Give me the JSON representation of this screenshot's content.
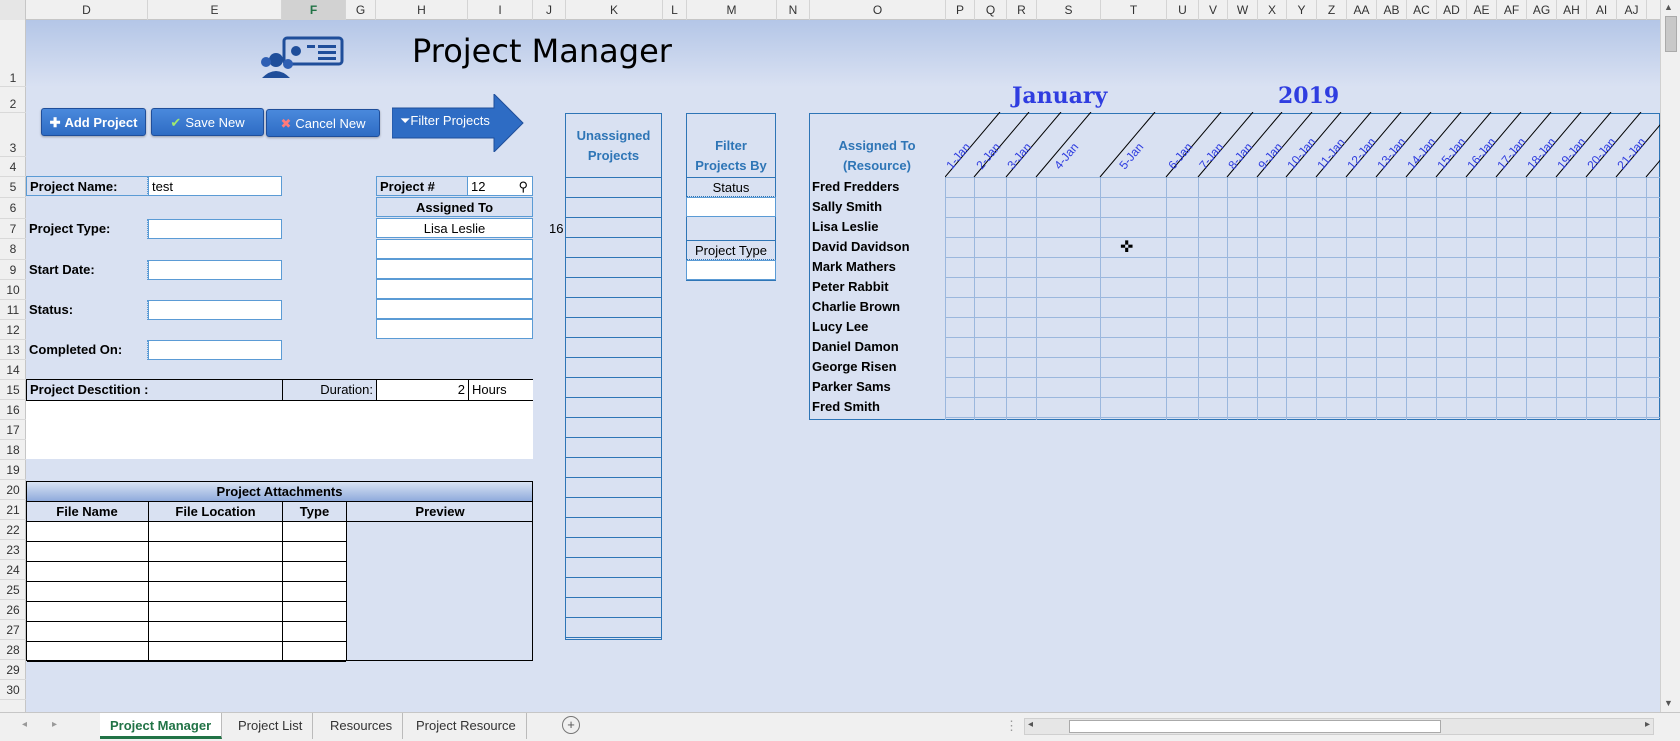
{
  "columns": [
    "D",
    "E",
    "F",
    "G",
    "H",
    "I",
    "J",
    "K",
    "L",
    "M",
    "N",
    "O",
    "P",
    "Q",
    "R",
    "S",
    "T",
    "U",
    "V",
    "W",
    "X",
    "Y",
    "Z",
    "AA",
    "AB",
    "AC",
    "AD",
    "AE",
    "AF",
    "AG",
    "AH",
    "AI",
    "AJ"
  ],
  "selected_column": "F",
  "rows": [
    "1",
    "2",
    "3",
    "4",
    "5",
    "6",
    "7",
    "8",
    "9",
    "10",
    "11",
    "12",
    "13",
    "14",
    "15",
    "16",
    "17",
    "18",
    "19",
    "20",
    "21",
    "22",
    "23",
    "24",
    "25",
    "26",
    "27",
    "28",
    "29",
    "30"
  ],
  "app": {
    "title": "Project Manager",
    "logo_icon": "project-team-icon"
  },
  "buttons": {
    "add_project": "Add Project",
    "save_new": "Save New",
    "cancel_new": "Cancel New",
    "filter_projects": "Filter Projects"
  },
  "form": {
    "project_name_label": "Project Name:",
    "project_name_value": "test",
    "project_type_label": "Project Type:",
    "start_date_label": "Start Date:",
    "status_label": "Status:",
    "completed_on_label": "Completed On:",
    "project_num_label": "Project #",
    "project_num_value": "12",
    "assigned_to_label": "Assigned To",
    "assigned_to_value": "Lisa Leslie",
    "side_number": "16",
    "description_label": "Project Desctition :",
    "duration_label": "Duration:",
    "duration_value": "2",
    "duration_unit": "Hours"
  },
  "unassigned": {
    "title_line1": "Unassigned",
    "title_line2": "Projects"
  },
  "filter": {
    "title_line1": "Filter",
    "title_line2": "Projects By",
    "status": "Status",
    "project_type": "Project Type"
  },
  "calendar": {
    "month": "January",
    "year": "2019",
    "assigned_header_line1": "Assigned To",
    "assigned_header_line2": "(Resource)",
    "days": [
      "1-Jan",
      "2-Jan",
      "3-Jan",
      "4-Jan",
      "5-Jan",
      "6-Jan",
      "7-Jan",
      "8-Jan",
      "9-Jan",
      "10-Jan",
      "11-Jan",
      "12-Jan",
      "13-Jan",
      "14-Jan",
      "15-Jan",
      "16-Jan",
      "17-Jan",
      "18-Jan",
      "19-Jan",
      "20-Jan",
      "21-Jan"
    ],
    "resources": [
      "Fred Fredders",
      "Sally Smith",
      "Lisa Leslie",
      "David Davidson",
      "Mark Mathers",
      "Peter Rabbit",
      "Charlie Brown",
      "Lucy Lee",
      "Daniel Damon",
      "George Risen",
      "Parker Sams",
      "Fred Smith"
    ]
  },
  "attachments": {
    "title": "Project Attachments",
    "headers": [
      "File Name",
      "File Location",
      "Type",
      "Preview"
    ]
  },
  "tabs": [
    "Project Manager",
    "Project List",
    "Resources",
    "Project Resource"
  ],
  "colors": {
    "header_blue": "#2e75b6",
    "sheet_bg": "#d9e1f2",
    "month_blue": "#2f3de0",
    "active_tab": "#217346"
  }
}
